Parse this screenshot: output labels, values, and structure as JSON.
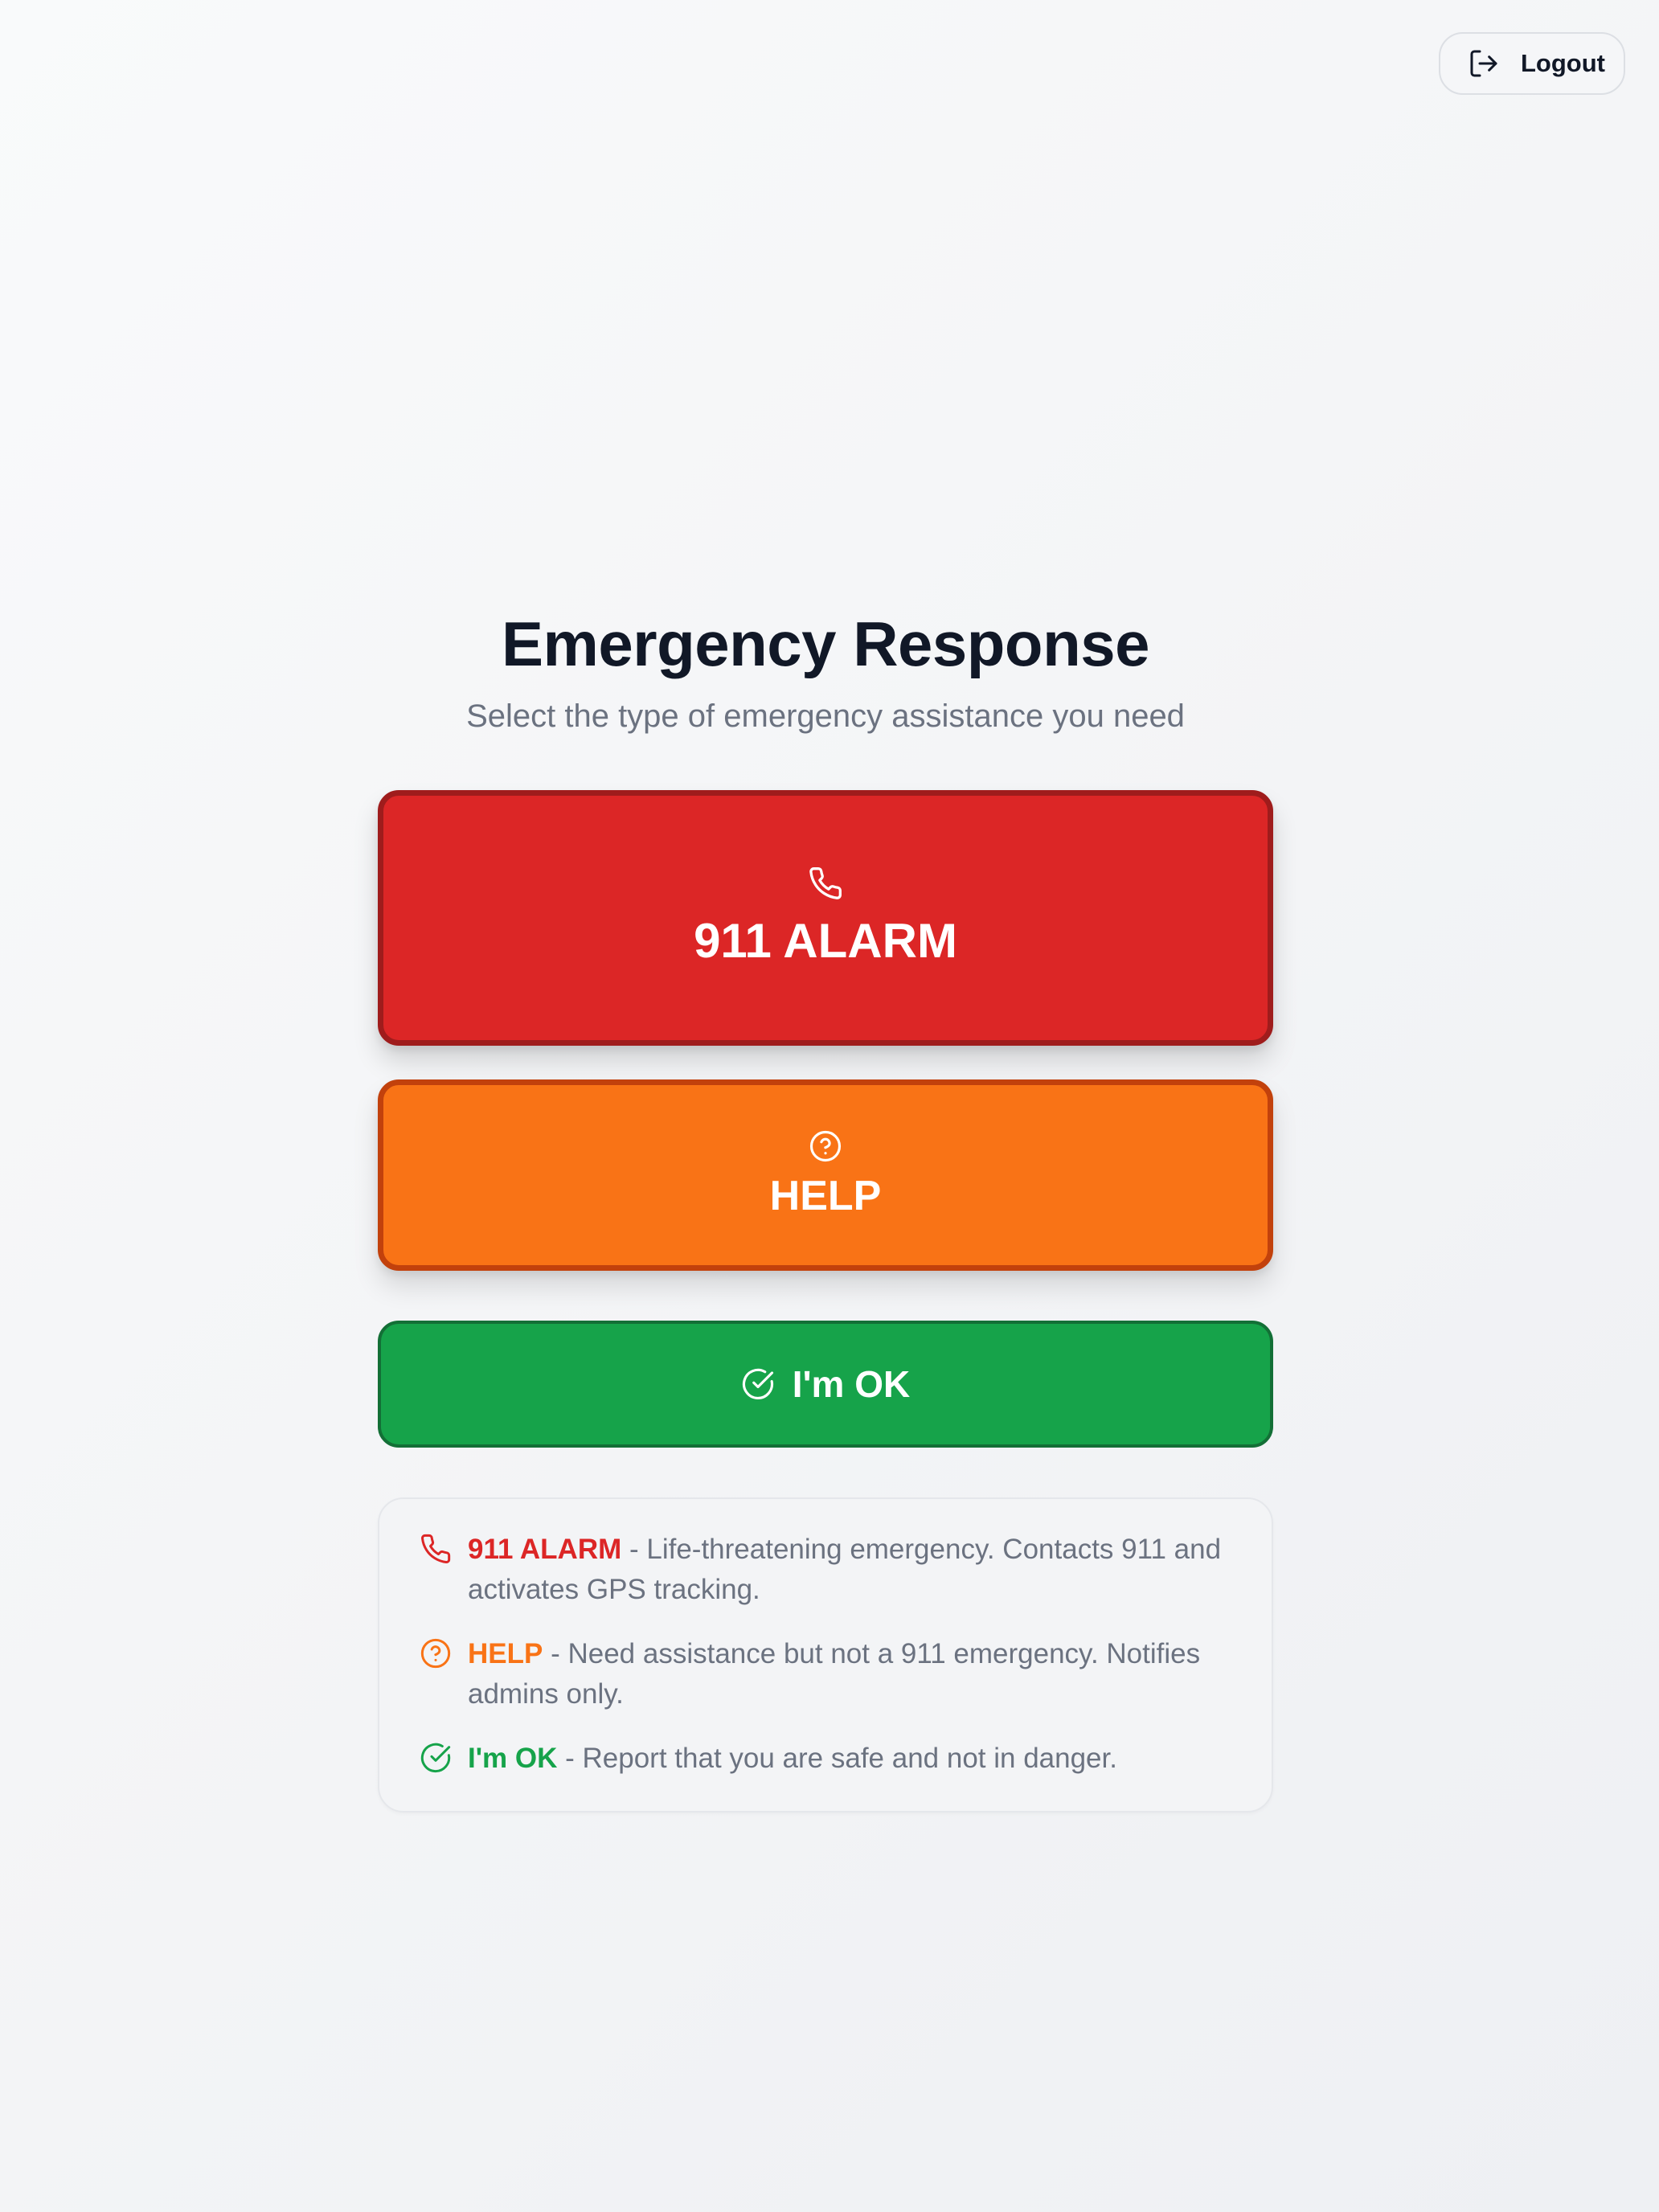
{
  "header": {
    "logout_label": "Logout",
    "logout_icon": "logout-icon"
  },
  "main": {
    "title": "Emergency Response",
    "subtitle": "Select the type of emergency assistance you need"
  },
  "buttons": {
    "alarm": {
      "label": "911 ALARM",
      "icon": "phone-icon",
      "color": "#dc2626",
      "border_color": "#9f1c1c"
    },
    "help": {
      "label": "HELP",
      "icon": "help-circle-icon",
      "color": "#f97316",
      "border_color": "#c2410c"
    },
    "ok": {
      "label": "I'm OK",
      "icon": "check-circle-icon",
      "color": "#16a34a",
      "border_color": "#136f36"
    }
  },
  "info": {
    "items": [
      {
        "title": "911 ALARM",
        "description": " - Life-threatening emergency. Contacts 911 and activates GPS tracking.",
        "icon": "phone-icon",
        "color": "#dc2626"
      },
      {
        "title": "HELP",
        "description": " - Need assistance but not a 911 emergency. Notifies admins only.",
        "icon": "help-circle-icon",
        "color": "#f97316"
      },
      {
        "title": "I'm OK",
        "description": " - Report that you are safe and not in danger.",
        "icon": "check-circle-icon",
        "color": "#16a34a"
      }
    ]
  }
}
